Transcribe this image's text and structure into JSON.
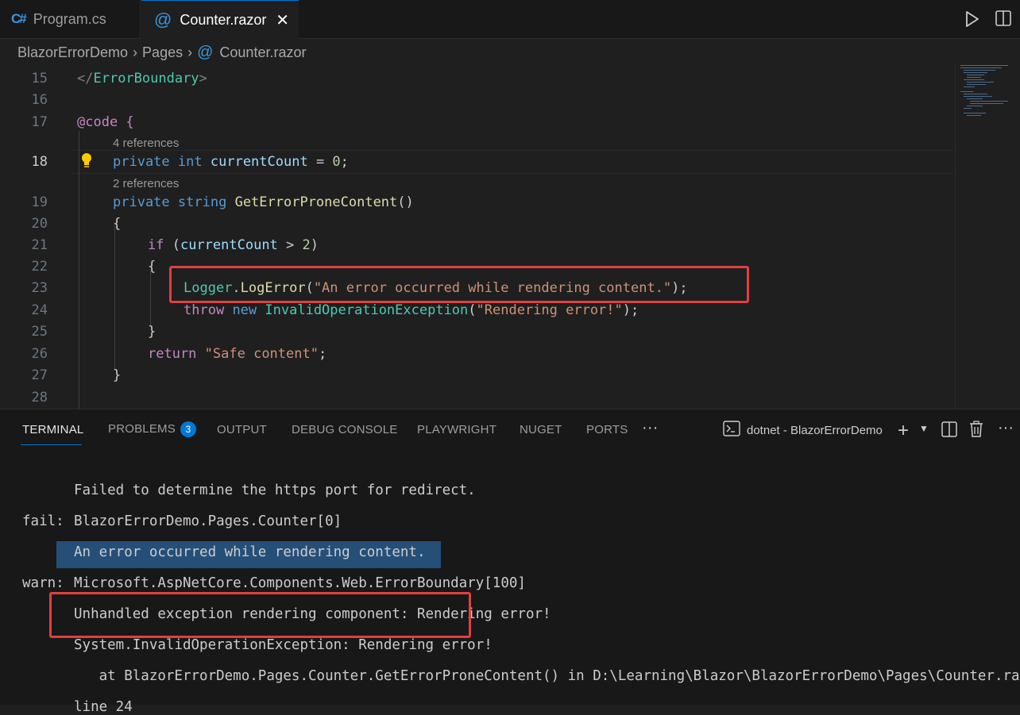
{
  "tabs": [
    {
      "icon": "csharp-icon",
      "label": "Program.cs",
      "active": false
    },
    {
      "icon": "razor-at-icon",
      "label": "Counter.razor",
      "active": true
    }
  ],
  "breadcrumb": {
    "project": "BlazorErrorDemo",
    "folder": "Pages",
    "file": "Counter.razor"
  },
  "editor": {
    "current_line": "18",
    "codelens": [
      "4 references",
      "2 references"
    ],
    "lines": [
      {
        "num": "15",
        "tokens": [
          "</",
          "ErrorBoundary",
          ">"
        ]
      },
      {
        "num": "16",
        "tokens": []
      },
      {
        "num": "17",
        "tokens": [
          "@code",
          " {"
        ]
      },
      {
        "num": "18",
        "tokens": [
          "private",
          " ",
          "int",
          " ",
          "currentCount",
          " = ",
          "0",
          ";"
        ]
      },
      {
        "num": "19",
        "tokens": [
          "private",
          " ",
          "string",
          " ",
          "GetErrorProneContent",
          "()"
        ]
      },
      {
        "num": "20",
        "tokens": [
          "{"
        ]
      },
      {
        "num": "21",
        "tokens": [
          "if",
          " (",
          "currentCount",
          " > ",
          "2",
          ")"
        ]
      },
      {
        "num": "22",
        "tokens": [
          "{"
        ]
      },
      {
        "num": "23",
        "tokens": [
          "Logger",
          ".",
          "LogError",
          "(",
          "\"An error occurred while rendering content.\"",
          ");"
        ]
      },
      {
        "num": "24",
        "tokens": [
          "throw",
          " ",
          "new",
          " ",
          "InvalidOperationException",
          "(",
          "\"Rendering error!\"",
          ");"
        ]
      },
      {
        "num": "25",
        "tokens": [
          "}"
        ]
      },
      {
        "num": "26",
        "tokens": [
          "return",
          " ",
          "\"Safe content\"",
          ";"
        ]
      },
      {
        "num": "27",
        "tokens": [
          "}"
        ]
      },
      {
        "num": "28",
        "tokens": []
      }
    ]
  },
  "panel": {
    "tabs": [
      "TERMINAL",
      "PROBLEMS",
      "OUTPUT",
      "DEBUG CONSOLE",
      "PLAYWRIGHT",
      "NUGET",
      "PORTS"
    ],
    "problems_count": "3",
    "more": "···",
    "terminal_name": "dotnet - BlazorErrorDemo"
  },
  "terminal": {
    "lines": [
      {
        "prefix": "",
        "text": "Failed to determine the https port for redirect."
      },
      {
        "prefix": "fail:",
        "text": "BlazorErrorDemo.Pages.Counter[0]"
      },
      {
        "prefix": "",
        "text": "An error occurred while rendering content."
      },
      {
        "prefix": "warn:",
        "text": "Microsoft.AspNetCore.Components.Web.ErrorBoundary[100]"
      },
      {
        "prefix": "",
        "text": "Unhandled exception rendering component: Rendering error!"
      },
      {
        "prefix": "",
        "text": "System.InvalidOperationException: Rendering error!"
      },
      {
        "prefix": "",
        "text": "   at BlazorErrorDemo.Pages.Counter.GetErrorProneContent() in D:\\Learning\\Blazor\\BlazorErrorDemo\\Pages\\Counter.razor"
      },
      {
        "prefix": "",
        "text": "line 24"
      }
    ]
  },
  "colors": {
    "highlight_box": "#e0403f",
    "selection": "#264f78",
    "accent": "#0078d4"
  }
}
